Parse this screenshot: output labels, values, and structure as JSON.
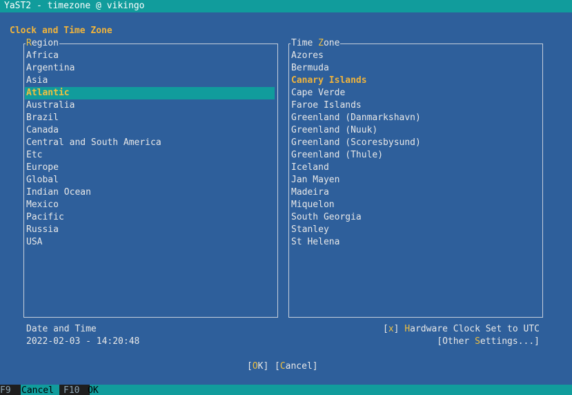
{
  "window": {
    "title": "YaST2 - timezone @ vikingo"
  },
  "dialog": {
    "heading": "Clock and Time Zone"
  },
  "region": {
    "label_hotkey": "R",
    "label_rest": "egion",
    "items": [
      "Africa",
      "Argentina",
      "Asia",
      "Atlantic",
      "Australia",
      "Brazil",
      "Canada",
      "Central and South America",
      "Etc",
      "Europe",
      "Global",
      "Indian Ocean",
      "Mexico",
      "Pacific",
      "Russia",
      "USA"
    ],
    "selected": "Atlantic"
  },
  "timezone": {
    "label_pre": "Time ",
    "label_hotkey": "Z",
    "label_rest": "one",
    "items": [
      "Azores",
      "Bermuda",
      "Canary Islands",
      "Cape Verde",
      "Faroe Islands",
      "Greenland (Danmarkshavn)",
      "Greenland (Nuuk)",
      "Greenland (Scoresbysund)",
      "Greenland (Thule)",
      "Iceland",
      "Jan Mayen",
      "Madeira",
      "Miquelon",
      "South Georgia",
      "Stanley",
      "St Helena"
    ],
    "selected": "Canary Islands"
  },
  "datetime": {
    "label": "Date and Time",
    "value": "2022-02-03 - 14:20:48"
  },
  "hwclock": {
    "open": "[",
    "mark": "x",
    "close": "] ",
    "hotkey": "H",
    "rest": "ardware Clock Set to UTC",
    "checked": true
  },
  "other_settings": {
    "pre": "[Other ",
    "hotkey": "S",
    "rest": "ettings...]"
  },
  "buttons": {
    "ok": {
      "open": "[",
      "hotkey": "O",
      "rest": "K]"
    },
    "cancel": {
      "open": "[",
      "hotkey": "C",
      "rest": "ancel]"
    }
  },
  "footer": {
    "f9_key": "F9",
    "f9_label": "Cancel",
    "f10_key": "F10",
    "f10_label": "OK"
  }
}
